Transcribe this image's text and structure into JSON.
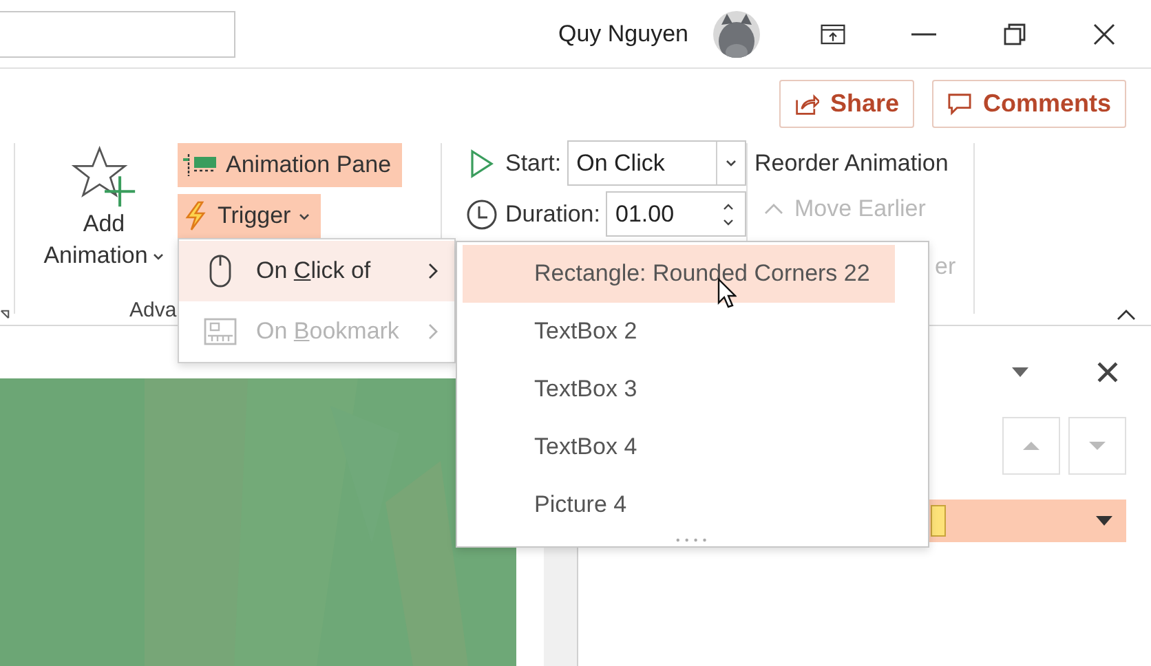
{
  "title_bar": {
    "user_name": "Quy Nguyen"
  },
  "share_button": {
    "label": "Share"
  },
  "comments_button": {
    "label": "Comments"
  },
  "ribbon": {
    "add_animation": {
      "line1": "Add",
      "line2": "Animation"
    },
    "group_label": "Adva",
    "animation_pane": {
      "label": "Animation Pane",
      "selected": true
    },
    "trigger": {
      "label": "Trigger",
      "selected": true
    },
    "start": {
      "label": "Start:",
      "value": "On Click"
    },
    "duration": {
      "label": "Duration:",
      "value": "01.00"
    },
    "reorder": {
      "title": "Reorder Animation",
      "move_earlier": {
        "label": "Move Earlier",
        "disabled": true
      },
      "move_later_partial": "er"
    }
  },
  "trigger_menu": [
    {
      "kind": "mouse",
      "label": {
        "before": "On ",
        "key": "C",
        "after": "lick of"
      },
      "selected": true,
      "disabled": false
    },
    {
      "kind": "bookmark",
      "label": {
        "before": "On ",
        "key": "B",
        "after": "ookmark"
      },
      "selected": false,
      "disabled": true
    }
  ],
  "target_menu": [
    {
      "label": "Rectangle: Rounded Corners 22",
      "selected": true
    },
    {
      "label": "TextBox 2",
      "selected": false
    },
    {
      "label": "TextBox 3",
      "selected": false
    },
    {
      "label": "TextBox 4",
      "selected": false
    },
    {
      "label": "Picture 4",
      "selected": false
    }
  ],
  "animation_list": [
    {
      "selected": true
    }
  ]
}
